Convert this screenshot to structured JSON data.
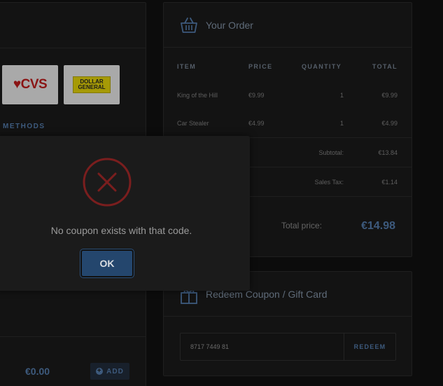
{
  "payment": {
    "stores": [
      {
        "name": "CVS",
        "logo_text": "♥CVS"
      },
      {
        "name": "Dollar General",
        "logo_line1": "DOLLAR",
        "logo_line2": "GENERAL"
      }
    ],
    "methods_label": "METHODS",
    "amount": "€0.00",
    "add_label": "ADD",
    "add_icon": "plus-circle-icon"
  },
  "order": {
    "title": "Your Order",
    "icon": "basket-icon",
    "columns": {
      "item": "ITEM",
      "price": "PRICE",
      "quantity": "QUANTITY",
      "total": "TOTAL"
    },
    "items": [
      {
        "name": "King of the Hill",
        "price": "€9.99",
        "quantity": "1",
        "total": "€9.99"
      },
      {
        "name": "Car Stealer",
        "price": "€4.99",
        "quantity": "1",
        "total": "€4.99"
      }
    ],
    "subtotal_label": "Subtotal:",
    "subtotal_value": "€13.84",
    "tax_label": "Sales Tax:",
    "tax_value": "€1.14",
    "total_label": "Total price:",
    "total_value": "€14.98"
  },
  "coupon": {
    "title": "Redeem Coupon / Gift Card",
    "icon": "gift-icon",
    "code_value": "8717 7449 81",
    "redeem_label": "REDEEM"
  },
  "modal": {
    "icon": "error-x-icon",
    "message": "No coupon exists with that code.",
    "ok_label": "OK"
  },
  "colors": {
    "accent": "#3d5a7d",
    "error": "#7a1e1e",
    "ok_button": "#24466d"
  }
}
